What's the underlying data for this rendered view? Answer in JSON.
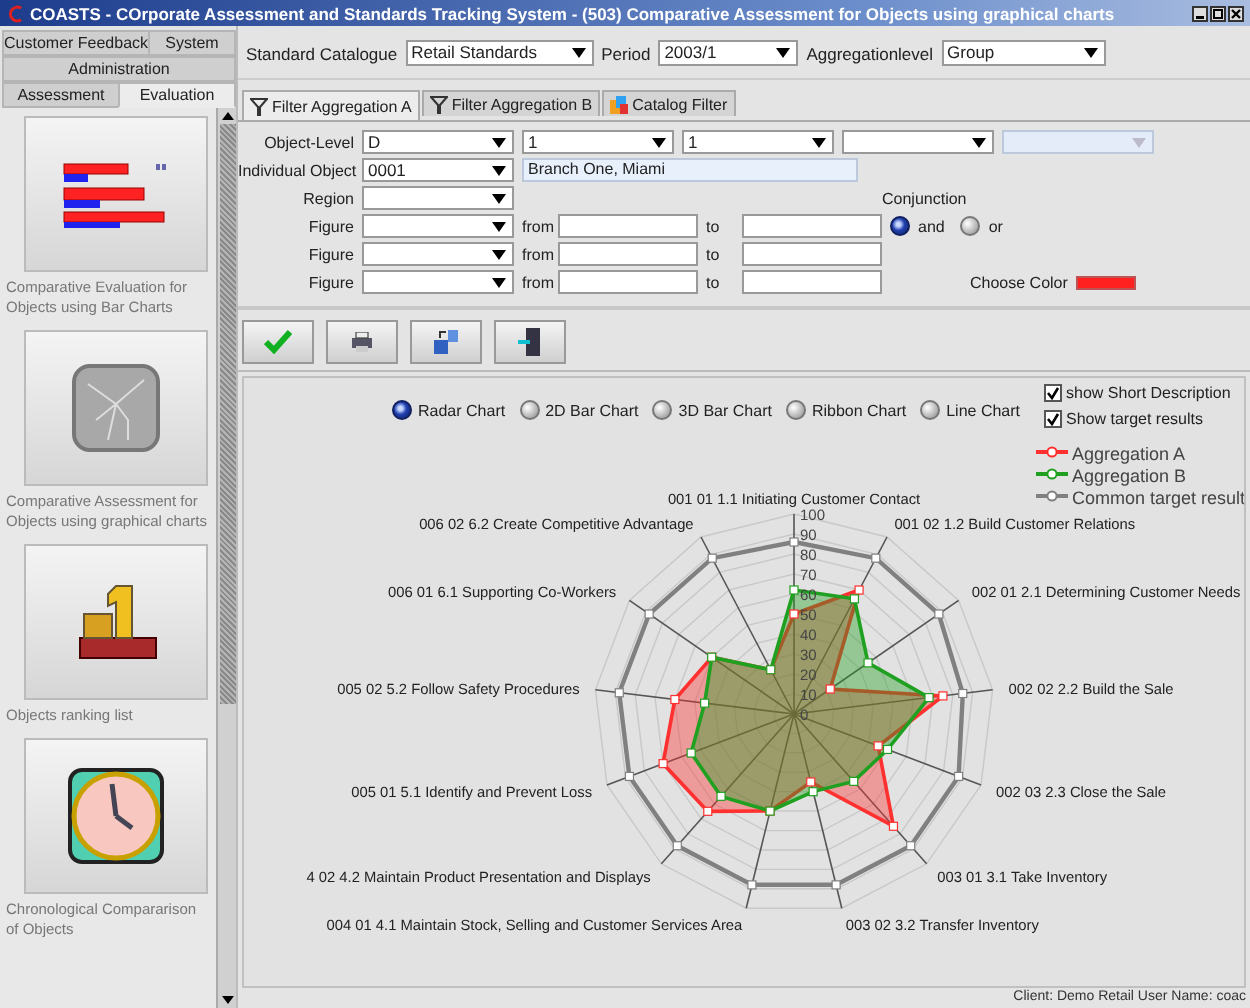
{
  "window": {
    "title": "COASTS - COrporate Assessment and Standards Tracking System - (503) Comparative Assessment for Objects using graphical charts"
  },
  "sidebar": {
    "tab_rows": [
      [
        {
          "label": "Customer Feedback",
          "selected": false
        },
        {
          "label": "System",
          "selected": false
        }
      ],
      [
        {
          "label": "Administration",
          "selected": false
        }
      ],
      [
        {
          "label": "Assessment",
          "selected": false
        },
        {
          "label": "Evaluation",
          "selected": true
        }
      ]
    ],
    "items": [
      {
        "kind": "bar-chart",
        "label": "Comparative Evaluation for Objects using Bar Charts"
      },
      {
        "kind": "radar",
        "label": "Comparative Assessment for Objects using graphical charts"
      },
      {
        "kind": "ranking",
        "label": "Objects ranking list"
      },
      {
        "kind": "clock",
        "label": "Chronological Compararison of Objects"
      }
    ]
  },
  "toolbar": [
    {
      "label": "Standard Catalogue",
      "value": "Retail Standards"
    },
    {
      "label": "Period",
      "value": "2003/1"
    },
    {
      "label": "Aggregationlevel",
      "value": "Group"
    }
  ],
  "filter_tabs": [
    {
      "label": "Filter Aggregation A",
      "kind": "funnel",
      "selected": true
    },
    {
      "label": "Filter Aggregation B",
      "kind": "funnel",
      "selected": false
    },
    {
      "label": "Catalog Filter",
      "kind": "catalog",
      "selected": false
    }
  ],
  "filter": {
    "object_level": {
      "label": "Object-Level",
      "dropdowns": [
        {
          "value": "D",
          "disabled": false
        },
        {
          "value": "1",
          "disabled": false
        },
        {
          "value": "1",
          "disabled": false
        },
        {
          "disabled": false
        },
        {
          "disabled": true
        }
      ]
    },
    "individual_object": {
      "label": "Individual Object",
      "code": "0001",
      "name": "Branch One, Miami"
    },
    "region": {
      "label": "Region"
    },
    "figures": [
      {
        "label": "Figure",
        "from": "from",
        "to": "to"
      },
      {
        "label": "Figure",
        "from": "from",
        "to": "to"
      },
      {
        "label": "Figure",
        "from": "from",
        "to": "to"
      }
    ],
    "conjunction": {
      "label": "Conjunction",
      "options": [
        {
          "label": "and",
          "selected": true
        },
        {
          "label": "or",
          "selected": false
        }
      ]
    },
    "choose_color": {
      "label": "Choose Color",
      "color": "#ff2020"
    }
  },
  "actions": [
    {
      "kind": "apply"
    },
    {
      "kind": "print"
    },
    {
      "kind": "export"
    },
    {
      "kind": "exit"
    }
  ],
  "chart": {
    "chart_types": [
      {
        "label": "Radar Chart",
        "selected": true
      },
      {
        "label": "2D Bar Chart",
        "selected": false
      },
      {
        "label": "3D Bar Chart",
        "selected": false
      },
      {
        "label": "Ribbon Chart",
        "selected": false
      },
      {
        "label": "Line Chart",
        "selected": false
      }
    ],
    "options": [
      {
        "label": "show Short Description",
        "checked": true
      },
      {
        "label": "Show target results",
        "checked": true
      }
    ],
    "radar": {
      "right_axis_labels": [
        "001 01 1.1 Initiating Customer Contact",
        "001 02 1.2 Build Customer Relations",
        "002 01 2.1 Determining Customer Needs",
        "002 02 2.2 Build the Sale",
        "002 03 2.3 Close the Sale",
        "003 01 3.1 Take Inventory",
        "003 02 3.2 Transfer Inventory"
      ],
      "left_axis_labels": [
        "006 02 6.2 Create Competitive Advantage",
        "006 01 6.1 Supporting Co-Workers",
        "005 02 5.2 Follow Safety Procedures",
        "005 01 5.1 Identify and Prevent Loss",
        "4 02 4.2 Maintain Product Presentation and Displays",
        "004 01 4.1 Maintain Stock, Selling and Customer Services Area"
      ],
      "ticks": [
        "100",
        "90",
        "80",
        "70",
        "60",
        "50",
        "40",
        "30",
        "20",
        "10",
        "0"
      ],
      "legend": [
        {
          "name": "Aggregation A",
          "color": "#ff3030"
        },
        {
          "name": "Aggregation B",
          "color": "#20a020"
        },
        {
          "name": "Common target result",
          "color": "#808080"
        }
      ]
    }
  },
  "status_bar": "Client: Demo Retail User Name: coac"
}
